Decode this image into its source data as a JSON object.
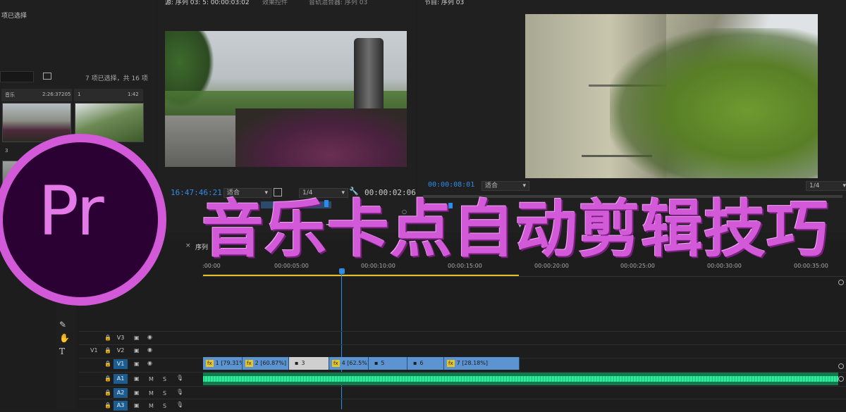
{
  "project_panel": {
    "selected_text_top": "项已选择",
    "selection_count": "7 项已选择，共 16 项",
    "item1_name": "音乐",
    "item1_duration": "2:26:37205",
    "item2_name": "1",
    "item2_duration": "1:42",
    "item3_label": "3"
  },
  "source_monitor": {
    "tabs": [
      "源: 序列 03: 5: 00:00:03:02",
      "效果控件",
      "音轨混合器: 序列 03"
    ],
    "timecode": "16:47:46:21",
    "fit": "适合",
    "quality": "1/4",
    "duration": "00:00:02:06"
  },
  "program_monitor": {
    "title": "节目: 序列 03",
    "timecode": "00:00:08:01",
    "fit": "适合",
    "quality": "1/4"
  },
  "overlay_title": {
    "logo_text": "Pr",
    "text": "音乐卡点自动剪辑技巧"
  },
  "timeline": {
    "tab_label": "序列",
    "ruler": [
      ":00:00",
      "00:00:05:00",
      "00:00:10:00",
      "00:00:15:00",
      "00:00:20:00",
      "00:00:25:00",
      "00:00:30:00",
      "00:00:35:00"
    ],
    "tracks": [
      {
        "name": "V3",
        "source": ""
      },
      {
        "name": "V2",
        "source": "V1"
      },
      {
        "name": "V1",
        "source": ""
      },
      {
        "name": "A1",
        "source": "",
        "m": "M",
        "s": "S"
      },
      {
        "name": "A2",
        "source": "",
        "m": "M",
        "s": "S"
      },
      {
        "name": "A3",
        "source": "",
        "m": "M",
        "s": "S"
      }
    ],
    "clips": [
      {
        "label": "1 [79.31%]",
        "fx": "fx"
      },
      {
        "label": "2 [60.87%]",
        "fx": "fx"
      },
      {
        "label": "3",
        "fx": ""
      },
      {
        "label": "4 [62.5%]",
        "fx": "fx"
      },
      {
        "label": "5",
        "fx": ""
      },
      {
        "label": "6",
        "fx": ""
      },
      {
        "label": "7 [28.18%]",
        "fx": "fx"
      }
    ]
  },
  "colors": {
    "accent_blue": "#2d8ceb",
    "clip_blue": "#5b94d1",
    "audio_green": "#1fbf78",
    "title_magenta": "#d25ad8",
    "logo_bg": "#2b0033"
  }
}
